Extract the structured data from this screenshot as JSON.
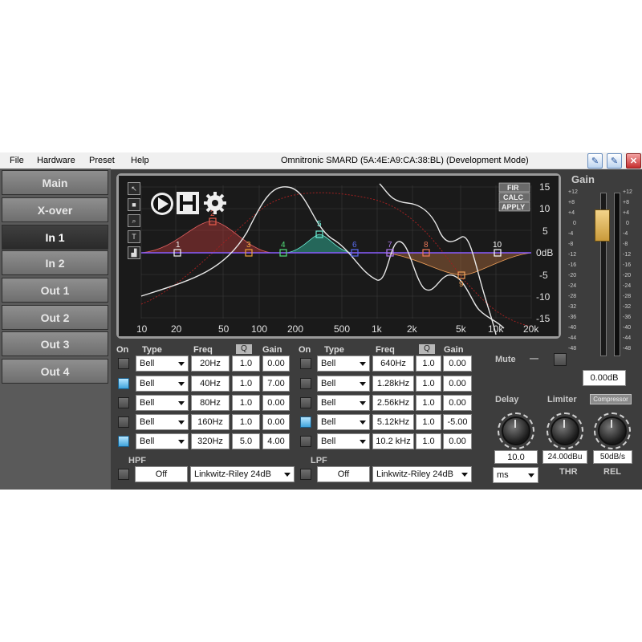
{
  "menu": {
    "file": "File",
    "hardware": "Hardware",
    "preset": "Preset",
    "help": "Help"
  },
  "window_title": "Omnitronic SMARD (5A:4E:A9:CA:38:BL) (Development Mode)",
  "sidebar": {
    "items": [
      {
        "label": "Main"
      },
      {
        "label": "X-over"
      },
      {
        "label": "In 1"
      },
      {
        "label": "In 2"
      },
      {
        "label": "Out 1"
      },
      {
        "label": "Out 2"
      },
      {
        "label": "Out 3"
      },
      {
        "label": "Out 4"
      }
    ],
    "active": "In 1"
  },
  "graph": {
    "fir_buttons": [
      "FIR",
      "CALC",
      "APPLY"
    ],
    "y_ticks": [
      "15",
      "10",
      "5",
      "0dB",
      "-5",
      "-10",
      "-15"
    ],
    "x_ticks": [
      "10",
      "20",
      "50",
      "100",
      "200",
      "500",
      "1k",
      "2k",
      "5k",
      "10k",
      "20k"
    ],
    "band_markers": [
      {
        "label": "1",
        "color": "#f2f2f2"
      },
      {
        "label": "2",
        "color": "#e85a4a"
      },
      {
        "label": "3",
        "color": "#f0a33a"
      },
      {
        "label": "4",
        "color": "#52e07a"
      },
      {
        "label": "5",
        "color": "#6ef0d8"
      },
      {
        "label": "6",
        "color": "#5a6cf0"
      },
      {
        "label": "7",
        "color": "#b07cf0"
      },
      {
        "label": "8",
        "color": "#f07a5a"
      },
      {
        "label": "9",
        "color": "#f0a05a"
      },
      {
        "label": "10",
        "color": "#ffffff"
      }
    ]
  },
  "eq_headers": {
    "on": "On",
    "type": "Type",
    "freq": "Freq",
    "q": "Q",
    "gain": "Gain"
  },
  "eq_left": [
    {
      "on": false,
      "type": "Bell",
      "freq": "20Hz",
      "q": "1.0",
      "gain": "0.00"
    },
    {
      "on": true,
      "type": "Bell",
      "freq": "40Hz",
      "q": "1.0",
      "gain": "7.00"
    },
    {
      "on": false,
      "type": "Bell",
      "freq": "80Hz",
      "q": "1.0",
      "gain": "0.00"
    },
    {
      "on": false,
      "type": "Bell",
      "freq": "160Hz",
      "q": "1.0",
      "gain": "0.00"
    },
    {
      "on": true,
      "type": "Bell",
      "freq": "320Hz",
      "q": "5.0",
      "gain": "4.00"
    }
  ],
  "eq_right": [
    {
      "on": false,
      "type": "Bell",
      "freq": "640Hz",
      "q": "1.0",
      "gain": "0.00"
    },
    {
      "on": false,
      "type": "Bell",
      "freq": "1.28kHz",
      "q": "1.0",
      "gain": "0.00"
    },
    {
      "on": false,
      "type": "Bell",
      "freq": "2.56kHz",
      "q": "1.0",
      "gain": "0.00"
    },
    {
      "on": true,
      "type": "Bell",
      "freq": "5.12kHz",
      "q": "1.0",
      "gain": "-5.00"
    },
    {
      "on": false,
      "type": "Bell",
      "freq": "10.2 kHz",
      "q": "1.0",
      "gain": "0.00"
    }
  ],
  "hpf": {
    "label": "HPF",
    "state": "Off",
    "type": "Linkwitz-Riley 24dB"
  },
  "lpf": {
    "label": "LPF",
    "state": "Off",
    "type": "Linkwitz-Riley 24dB"
  },
  "gain": {
    "title": "Gain",
    "scale": [
      "+12",
      "+8",
      "+4",
      "0",
      "-4",
      "-8",
      "-12",
      "-16",
      "-20",
      "-24",
      "-28",
      "-32",
      "-36",
      "-40",
      "-44",
      "-48"
    ],
    "value": "0.00dB"
  },
  "mute": {
    "label": "Mute",
    "dash": "—"
  },
  "delay": {
    "label": "Delay",
    "value": "10.0",
    "unit": "ms"
  },
  "limiter": {
    "label": "Limiter",
    "compressor_label": "Compressor",
    "thr_value": "24.00dBu",
    "thr_label": "THR",
    "rel_value": "50dB/s",
    "rel_label": "REL"
  },
  "colors": {
    "panel_bg": "#3d3d3d",
    "graph_bg": "#1a1a1a",
    "accent_blue": "#3fa4dc",
    "flat_line": "#8a5cff"
  }
}
